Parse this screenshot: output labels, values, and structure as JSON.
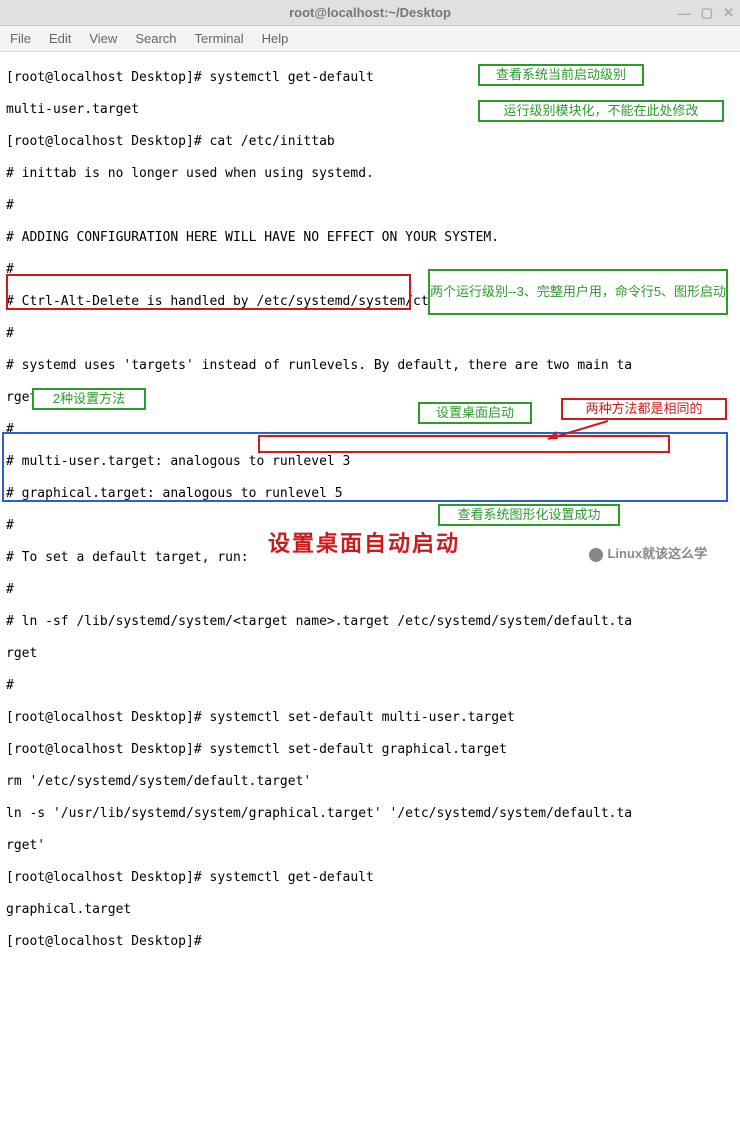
{
  "window": {
    "title": "root@localhost:~/Desktop",
    "min": "—",
    "max": "▢",
    "close": "✕"
  },
  "menu": {
    "file": "File",
    "edit": "Edit",
    "view": "View",
    "search": "Search",
    "terminal": "Terminal",
    "help": "Help"
  },
  "lines": {
    "l1": "[root@localhost Desktop]# systemctl get-default",
    "l2": "multi-user.target",
    "l3": "[root@localhost Desktop]# cat /etc/inittab",
    "l4": "# inittab is no longer used when using systemd.",
    "l5": "#",
    "l6": "# ADDING CONFIGURATION HERE WILL HAVE NO EFFECT ON YOUR SYSTEM.",
    "l7": "#",
    "l8": "# Ctrl-Alt-Delete is handled by /etc/systemd/system/ctrl-alt-del.target",
    "l9": "#",
    "l10": "# systemd uses 'targets' instead of runlevels. By default, there are two main ta",
    "l11": "rgets:",
    "l12": "#",
    "l13": "# multi-user.target: analogous to runlevel 3",
    "l14": "# graphical.target: analogous to runlevel 5",
    "l15": "#",
    "l16": "# To set a default target, run:",
    "l17": "#",
    "l18": "# ln -sf /lib/systemd/system/<target name>.target /etc/systemd/system/default.ta",
    "l19": "rget",
    "l20": "#",
    "l21": "[root@localhost Desktop]# systemctl set-default multi-user.target",
    "l22": "[root@localhost Desktop]# systemctl set-default graphical.target",
    "l23": "rm '/etc/systemd/system/default.target'",
    "l24": "ln -s '/usr/lib/systemd/system/graphical.target' '/etc/systemd/system/default.ta",
    "l25": "rget'",
    "l26": "[root@localhost Desktop]# systemctl get-default",
    "l27": "graphical.target",
    "l28": "[root@localhost Desktop]# "
  },
  "annot": {
    "a1": "查看系统当前启动级别",
    "a2": "运行级别模块化，不能在此处修改",
    "a3": "两个运行级别--3、完整用户用，命令行5、图形启动",
    "a4": "2种设置方法",
    "a5": "设置桌面启动",
    "a6": "两种方法都是相同的",
    "a7": "查看系统图形化设置成功",
    "caption": "设置桌面自动启动",
    "watermark": "Linux就该这么学"
  }
}
